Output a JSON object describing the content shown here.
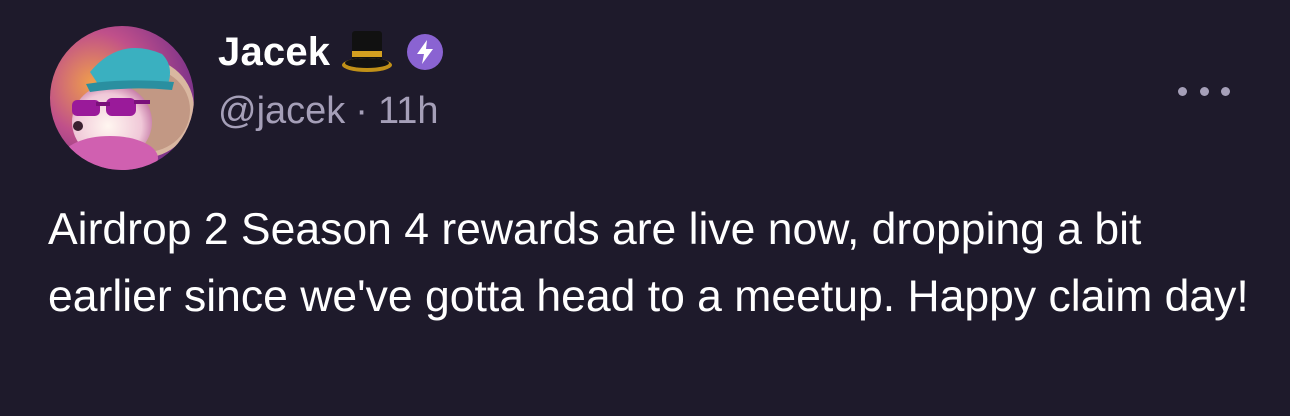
{
  "post": {
    "author": {
      "display_name": "Jacek",
      "handle": "@jacek",
      "emoji_icon": "top-hat-icon",
      "badge_icon": "power-badge-icon",
      "avatar_icon": "hedgehog-avatar"
    },
    "separator": "·",
    "time_ago": "11h",
    "menu_icon": "more-options-icon",
    "text": "Airdrop 2 Season 4 rewards are live now, dropping a bit earlier since we've gotta head to a meetup. Happy claim day!"
  },
  "colors": {
    "background": "#1e1a2b",
    "text_primary": "#ffffff",
    "text_secondary": "#a59fb8",
    "badge": "#8a63d2"
  }
}
